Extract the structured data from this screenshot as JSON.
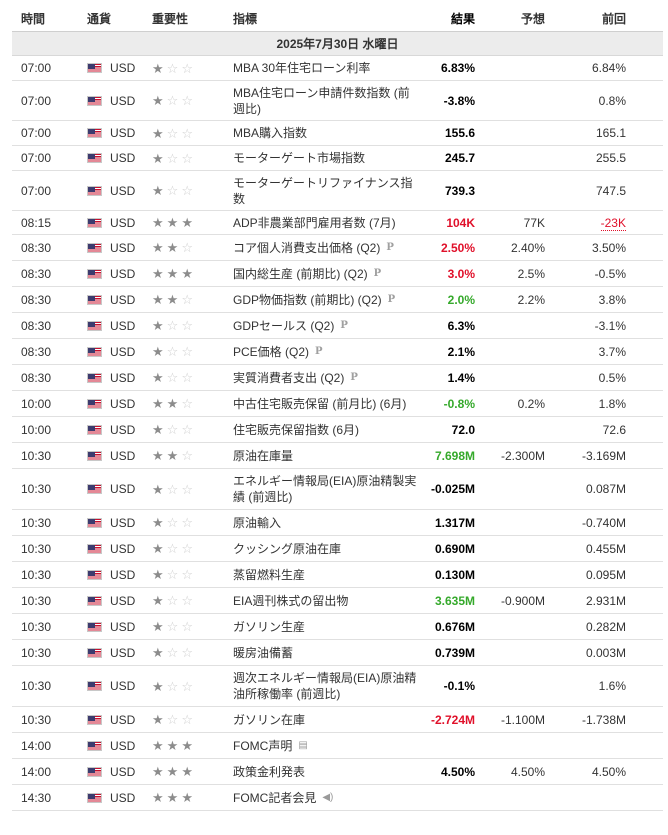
{
  "header": {
    "time": "時間",
    "currency": "通貨",
    "importance": "重要性",
    "event": "指標",
    "actual": "結果",
    "forecast": "予想",
    "previous": "前回"
  },
  "date": "2025年7月30日 水曜日",
  "rows": [
    {
      "time": "07:00",
      "cur": "USD",
      "imp": 1,
      "event": "MBA 30年住宅ローン利率",
      "actual": "6.83%",
      "forecast": "",
      "previous": "6.84%"
    },
    {
      "time": "07:00",
      "cur": "USD",
      "imp": 1,
      "event": "MBA住宅ローン申請件数指数 (前週比)",
      "actual": "-3.8%",
      "forecast": "",
      "previous": "0.8%"
    },
    {
      "time": "07:00",
      "cur": "USD",
      "imp": 1,
      "event": "MBA購入指数",
      "actual": "155.6",
      "forecast": "",
      "previous": "165.1"
    },
    {
      "time": "07:00",
      "cur": "USD",
      "imp": 1,
      "event": "モーターゲート市場指数",
      "actual": "245.7",
      "forecast": "",
      "previous": "255.5"
    },
    {
      "time": "07:00",
      "cur": "USD",
      "imp": 1,
      "event": "モーターゲートリファイナンス指数",
      "actual": "739.3",
      "forecast": "",
      "previous": "747.5"
    },
    {
      "time": "08:15",
      "cur": "USD",
      "imp": 3,
      "event": "ADP非農業部門雇用者数 (7月)",
      "actual": "104K",
      "actual_color": "red",
      "forecast": "77K",
      "previous": "-23K",
      "previous_color": "red"
    },
    {
      "time": "08:30",
      "cur": "USD",
      "imp": 2,
      "event": "コア個人消費支出価格 (Q2)",
      "p": "P",
      "actual": "2.50%",
      "actual_color": "red",
      "forecast": "2.40%",
      "previous": "3.50%"
    },
    {
      "time": "08:30",
      "cur": "USD",
      "imp": 3,
      "event": "国内総生産 (前期比) (Q2)",
      "p": "P",
      "actual": "3.0%",
      "actual_color": "red",
      "forecast": "2.5%",
      "previous": "-0.5%"
    },
    {
      "time": "08:30",
      "cur": "USD",
      "imp": 2,
      "event": "GDP物価指数 (前期比) (Q2)",
      "p": "P",
      "actual": "2.0%",
      "actual_color": "green",
      "forecast": "2.2%",
      "previous": "3.8%"
    },
    {
      "time": "08:30",
      "cur": "USD",
      "imp": 1,
      "event": "GDPセールス (Q2)",
      "p": "P",
      "actual": "6.3%",
      "forecast": "",
      "previous": "-3.1%"
    },
    {
      "time": "08:30",
      "cur": "USD",
      "imp": 1,
      "event": "PCE価格 (Q2)",
      "p": "P",
      "actual": "2.1%",
      "forecast": "",
      "previous": "3.7%"
    },
    {
      "time": "08:30",
      "cur": "USD",
      "imp": 1,
      "event": "実質消費者支出 (Q2)",
      "p": "P",
      "actual": "1.4%",
      "forecast": "",
      "previous": "0.5%"
    },
    {
      "time": "10:00",
      "cur": "USD",
      "imp": 2,
      "event": "中古住宅販売保留 (前月比) (6月)",
      "actual": "-0.8%",
      "actual_color": "green",
      "forecast": "0.2%",
      "previous": "1.8%"
    },
    {
      "time": "10:00",
      "cur": "USD",
      "imp": 1,
      "event": "住宅販売保留指数 (6月)",
      "actual": "72.0",
      "forecast": "",
      "previous": "72.6"
    },
    {
      "time": "10:30",
      "cur": "USD",
      "imp": 2,
      "event": "原油在庫量",
      "actual": "7.698M",
      "actual_color": "green",
      "forecast": "-2.300M",
      "previous": "-3.169M"
    },
    {
      "time": "10:30",
      "cur": "USD",
      "imp": 1,
      "event": "エネルギー情報局(EIA)原油精製実績 (前週比)",
      "actual": "-0.025M",
      "forecast": "",
      "previous": "0.087M"
    },
    {
      "time": "10:30",
      "cur": "USD",
      "imp": 1,
      "event": "原油輸入",
      "actual": "1.317M",
      "forecast": "",
      "previous": "-0.740M"
    },
    {
      "time": "10:30",
      "cur": "USD",
      "imp": 1,
      "event": "クッシング原油在庫",
      "actual": "0.690M",
      "forecast": "",
      "previous": "0.455M"
    },
    {
      "time": "10:30",
      "cur": "USD",
      "imp": 1,
      "event": "蒸留燃料生産",
      "actual": "0.130M",
      "forecast": "",
      "previous": "0.095M"
    },
    {
      "time": "10:30",
      "cur": "USD",
      "imp": 1,
      "event": "EIA週刊株式の留出物",
      "actual": "3.635M",
      "actual_color": "green",
      "forecast": "-0.900M",
      "previous": "2.931M"
    },
    {
      "time": "10:30",
      "cur": "USD",
      "imp": 1,
      "event": "ガソリン生産",
      "actual": "0.676M",
      "forecast": "",
      "previous": "0.282M"
    },
    {
      "time": "10:30",
      "cur": "USD",
      "imp": 1,
      "event": "暖房油備蓄",
      "actual": "0.739M",
      "forecast": "",
      "previous": "0.003M"
    },
    {
      "time": "10:30",
      "cur": "USD",
      "imp": 1,
      "event": "週次エネルギー情報局(EIA)原油精油所稼働率 (前週比)",
      "actual": "-0.1%",
      "forecast": "",
      "previous": "1.6%"
    },
    {
      "time": "10:30",
      "cur": "USD",
      "imp": 1,
      "event": "ガソリン在庫",
      "actual": "-2.724M",
      "actual_color": "red",
      "forecast": "-1.100M",
      "previous": "-1.738M"
    },
    {
      "time": "14:00",
      "cur": "USD",
      "imp": 3,
      "event": "FOMC声明",
      "icon": "document-icon",
      "actual": "",
      "forecast": "",
      "previous": ""
    },
    {
      "time": "14:00",
      "cur": "USD",
      "imp": 3,
      "event": "政策金利発表",
      "actual": "4.50%",
      "forecast": "4.50%",
      "previous": "4.50%"
    },
    {
      "time": "14:30",
      "cur": "USD",
      "imp": 3,
      "event": "FOMC記者会見",
      "icon": "speaker-icon",
      "actual": "",
      "forecast": "",
      "previous": ""
    }
  ],
  "colors": {
    "red": "#e0102a",
    "green": "#35a92b",
    "date_bg": "#ececec"
  }
}
